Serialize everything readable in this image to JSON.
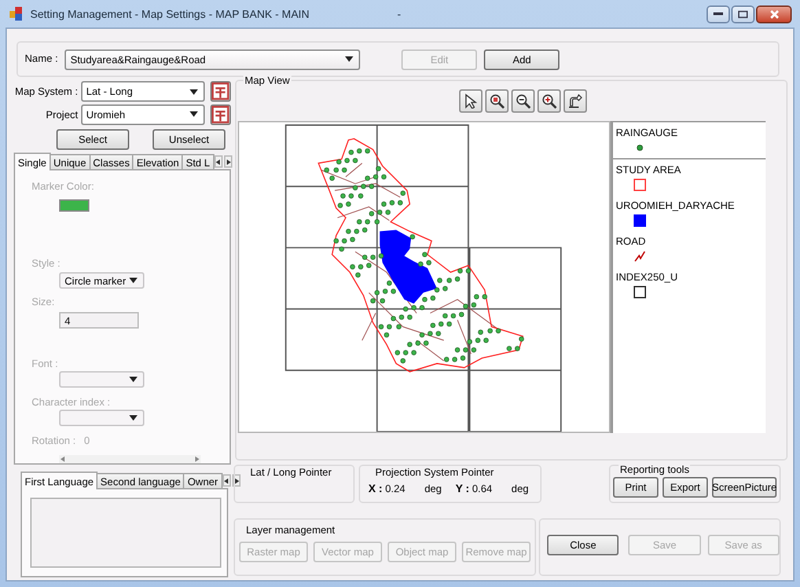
{
  "window": {
    "title": "Setting Management - Map Settings - MAP BANK - MAIN",
    "title_mark": "-"
  },
  "name_row": {
    "label": "Name :",
    "value": "Studyarea&Raingauge&Road",
    "buttons": [
      {
        "label": "Edit",
        "disabled": true
      },
      {
        "label": "Add",
        "disabled": false
      }
    ]
  },
  "map_system": {
    "label": "Map System :",
    "value": "Lat - Long"
  },
  "project": {
    "label": "Project",
    "value": "Uromieh"
  },
  "select_buttons": [
    "Select",
    "Unselect"
  ],
  "style_tabs": [
    {
      "label": "Single",
      "selected": true
    },
    {
      "label": "Unique",
      "selected": false
    },
    {
      "label": "Classes",
      "selected": false
    },
    {
      "label": "Elevation",
      "selected": false
    },
    {
      "label": "Std L",
      "selected": false
    }
  ],
  "single_panel": {
    "disabled": true,
    "marker_color_label": "Marker Color:",
    "marker_swatch": {
      "color": "#3cb44a"
    },
    "style_label": "Style :",
    "style_value": "Circle marker",
    "size_label": "Size:",
    "size_value": "4",
    "font_label": "Font :",
    "char_index_label": "Character index :",
    "rotation_label": "Rotation :",
    "rotation_value": "0"
  },
  "language_tabs": [
    {
      "label": "First Language",
      "selected": true
    },
    {
      "label": "Second language",
      "selected": false
    },
    {
      "label": "Owner",
      "selected": false
    }
  ],
  "map_view": {
    "title": "Map View",
    "legend": [
      {
        "name": "RAINGAUGE",
        "kind": "point",
        "color": "#2e9e3e"
      },
      {
        "name": "STUDY AREA",
        "kind": "outline",
        "color": "#ff4040"
      },
      {
        "name": "UROOMIEH_DARYACHE",
        "kind": "fill",
        "color": "#0000ff"
      },
      {
        "name": "ROAD",
        "kind": "line",
        "color": "#c00000"
      },
      {
        "name": "INDEX250_U",
        "kind": "outline",
        "color": "#303030"
      }
    ]
  },
  "lat_long_pointer": {
    "title": "Lat / Long Pointer"
  },
  "projection_pointer": {
    "title": "Projection System Pointer",
    "x_label": "X :",
    "x_value": "0.24",
    "x_unit": "deg",
    "y_label": "Y :",
    "y_value": "0.64",
    "y_unit": "deg"
  },
  "reporting_tools": {
    "title": "Reporting tools",
    "buttons": [
      "Print",
      "Export",
      "ScreenPicture"
    ]
  },
  "layer_management": {
    "title": "Layer management",
    "buttons": [
      {
        "label": "Raster map",
        "disabled": true
      },
      {
        "label": "Vector map",
        "disabled": true
      },
      {
        "label": "Object map",
        "disabled": true
      },
      {
        "label": "Remove map",
        "disabled": true
      }
    ]
  },
  "dialog_buttons": [
    {
      "label": "Close",
      "disabled": false
    },
    {
      "label": "Save",
      "disabled": true
    },
    {
      "label": "Save as",
      "disabled": true
    }
  ]
}
